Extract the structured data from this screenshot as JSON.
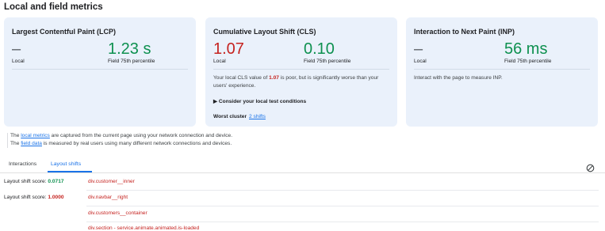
{
  "page": {
    "title": "Local and field metrics"
  },
  "cards": {
    "lcp": {
      "title": "Largest Contentful Paint (LCP)",
      "local_value": "–",
      "local_label": "Local",
      "field_value": "1.23 s",
      "field_label": "Field 75th percentile"
    },
    "cls": {
      "title": "Cumulative Layout Shift (CLS)",
      "local_value": "1.07",
      "local_label": "Local",
      "field_value": "0.10",
      "field_label": "Field 75th percentile",
      "desc_pre": "Your local CLS value of ",
      "desc_value": "1.07",
      "desc_post": " is poor, but is significantly worse than your users' experience.",
      "details_label": "Consider your local test conditions",
      "worst_cluster_label": "Worst cluster",
      "worst_cluster_link": "2 shifts"
    },
    "inp": {
      "title": "Interaction to Next Paint (INP)",
      "local_value": "–",
      "local_label": "Local",
      "field_value": "56 ms",
      "field_label": "Field 75th percentile",
      "desc": "Interact with the page to measure INP."
    }
  },
  "note": {
    "line1_pre": "The ",
    "line1_link": "local metrics",
    "line1_post": " are captured from the current page using your network connection and device.",
    "line2_pre": "The ",
    "line2_link": "field data",
    "line2_post": " is measured by real users using many different network connections and devices."
  },
  "tabs": [
    {
      "label": "Interactions",
      "active": false
    },
    {
      "label": "Layout shifts",
      "active": true
    }
  ],
  "shifts": [
    {
      "score_label": "Layout shift score:",
      "score_value": "0.0717",
      "score_color": "#0d904f",
      "nodes": [
        "div.customer__inner"
      ]
    },
    {
      "score_label": "Layout shift score:",
      "score_value": "1.0000",
      "score_color": "#c5221f",
      "nodes": [
        "div.navbar__right",
        "div.customers__container",
        "div.section - service.animate.animated.is-loaded"
      ]
    }
  ],
  "icons": {
    "clear": "clear-icon",
    "disclosure": "triangle-right-icon"
  },
  "colors": {
    "good": "#0d904f",
    "poor": "#c5221f",
    "link": "#1a73e8",
    "card_bg": "#eaf1fb"
  }
}
